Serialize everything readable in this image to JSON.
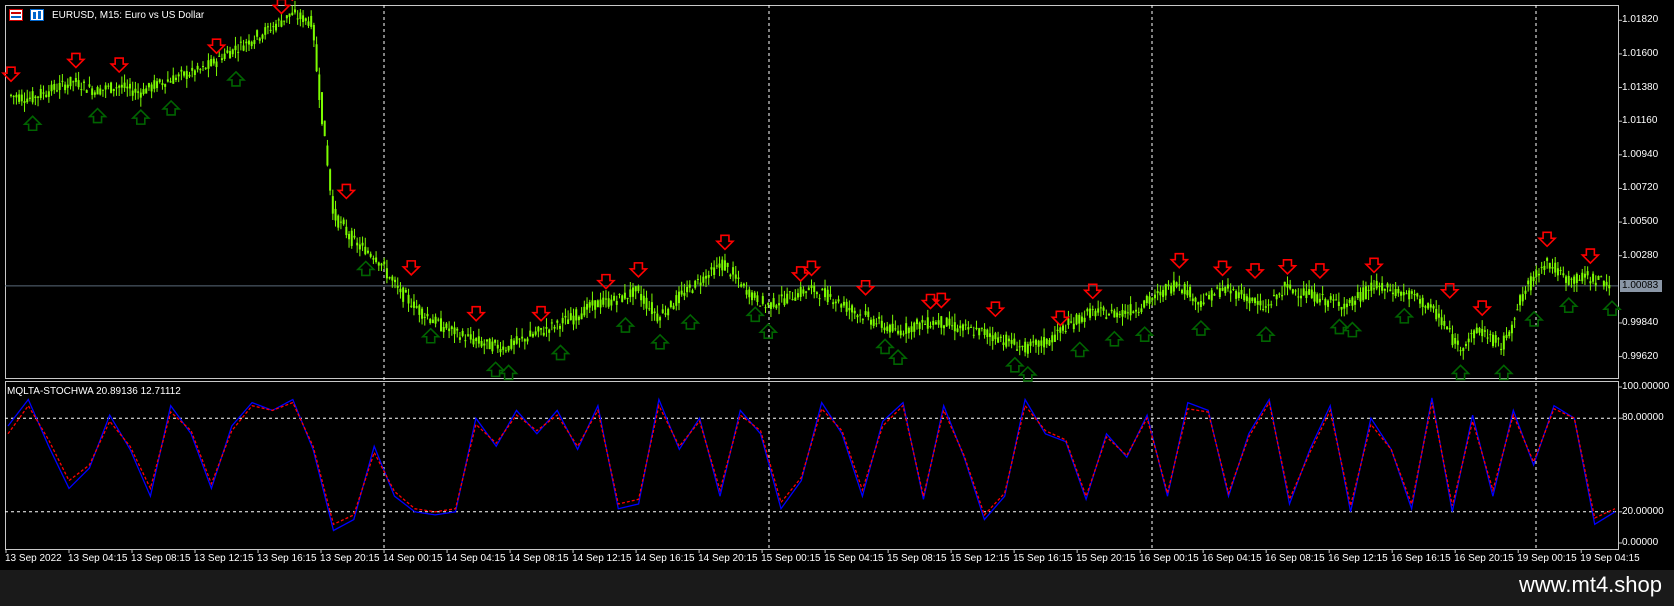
{
  "chart_title": "EURUSD, M15:  Euro vs US Dollar",
  "indicator_title": "MQLTA-STOCHWA 20.89136 12.71112",
  "current_price": "1.00083",
  "watermark": "www.mt4.shop",
  "price_axis_labels": [
    "1.01820",
    "1.01600",
    "1.01380",
    "1.01160",
    "1.00940",
    "1.00720",
    "1.00500",
    "1.00280",
    "0.99840",
    "0.99620"
  ],
  "indicator_axis_labels": [
    "100.00000",
    "80.00000",
    "20.00000",
    "0.00000"
  ],
  "time_labels": [
    "13 Sep 2022",
    "13 Sep 04:15",
    "13 Sep 08:15",
    "13 Sep 12:15",
    "13 Sep 16:15",
    "13 Sep 20:15",
    "14 Sep 00:15",
    "14 Sep 04:15",
    "14 Sep 08:15",
    "14 Sep 12:15",
    "14 Sep 16:15",
    "14 Sep 20:15",
    "15 Sep 00:15",
    "15 Sep 04:15",
    "15 Sep 08:15",
    "15 Sep 12:15",
    "15 Sep 16:15",
    "15 Sep 20:15",
    "16 Sep 00:15",
    "16 Sep 04:15",
    "16 Sep 08:15",
    "16 Sep 12:15",
    "16 Sep 16:15",
    "16 Sep 20:15",
    "19 Sep 00:15",
    "19 Sep 04:15"
  ],
  "colors": {
    "background": "#000000",
    "grid": "#ffffff",
    "candle": "#7cfc00",
    "up_arrow": "#006400",
    "down_arrow": "#ff0000",
    "stoch_main": "#0000ff",
    "stoch_signal": "#ff0000",
    "price_line": "#5a6a7a"
  },
  "icons": [
    "chart-menu-icon",
    "trading-icon"
  ],
  "chart_data": {
    "type": "line",
    "symbol": "EURUSD",
    "timeframe": "M15",
    "price_range": [
      0.9948,
      1.0192
    ],
    "current_price": 1.00083,
    "close_approx": [
      1.0133,
      1.0131,
      1.0137,
      1.0142,
      1.0136,
      1.0139,
      1.0135,
      1.0141,
      1.0146,
      1.015,
      1.016,
      1.0168,
      1.0176,
      1.0186,
      1.0181,
      1.0055,
      1.0036,
      1.0027,
      1.0005,
      0.9992,
      0.9982,
      0.9975,
      0.997,
      0.9968,
      0.9975,
      0.9981,
      0.9987,
      0.9996,
      0.9999,
      1.0005,
      0.9988,
      1.0001,
      1.0013,
      1.0023,
      1.0006,
      0.9995,
      1.0001,
      1.0006,
      1.0001,
      0.9992,
      0.9985,
      0.9978,
      0.9983,
      0.9985,
      0.998,
      0.9978,
      0.9973,
      0.9967,
      0.9972,
      0.9983,
      0.9991,
      0.999,
      0.9993,
      1.0001,
      1.0011,
      0.9997,
      1.0006,
      1.0003,
      0.9993,
      1.0007,
      1.0003,
      0.9998,
      0.9996,
      1.0008,
      1.0005,
      1.0001,
      0.999,
      0.9968,
      0.998,
      0.9968,
      1.0003,
      1.0025,
      1.0012,
      1.0014,
      1.001
    ],
    "indicator": {
      "name": "MQLTA-STOCHWA",
      "main": 20.89136,
      "signal": 12.71112,
      "range": [
        0,
        100
      ],
      "levels": [
        80,
        20
      ],
      "main_series": [
        75,
        92,
        62,
        35,
        48,
        82,
        60,
        30,
        88,
        70,
        35,
        75,
        90,
        85,
        92,
        60,
        8,
        15,
        62,
        30,
        20,
        18,
        20,
        80,
        62,
        85,
        70,
        85,
        60,
        88,
        22,
        25,
        92,
        60,
        80,
        30,
        85,
        70,
        22,
        40,
        90,
        70,
        30,
        78,
        90,
        28,
        88,
        55,
        15,
        30,
        92,
        70,
        65,
        28,
        70,
        55,
        82,
        30,
        90,
        85,
        30,
        70,
        92,
        25,
        60,
        88,
        20,
        80,
        60,
        22,
        93,
        20,
        82,
        30,
        85,
        50,
        88,
        80,
        12,
        20
      ],
      "signal_series": [
        70,
        88,
        66,
        40,
        50,
        78,
        62,
        35,
        84,
        72,
        38,
        72,
        88,
        85,
        90,
        62,
        12,
        18,
        58,
        33,
        22,
        20,
        22,
        76,
        64,
        82,
        72,
        82,
        62,
        85,
        25,
        28,
        88,
        62,
        78,
        34,
        82,
        72,
        26,
        42,
        86,
        72,
        34,
        75,
        88,
        30,
        85,
        56,
        18,
        32,
        88,
        72,
        66,
        30,
        68,
        56,
        80,
        32,
        86,
        84,
        32,
        68,
        90,
        28,
        58,
        85,
        24,
        76,
        60,
        25,
        90,
        24,
        78,
        34,
        82,
        52,
        86,
        80,
        16,
        22
      ]
    }
  }
}
